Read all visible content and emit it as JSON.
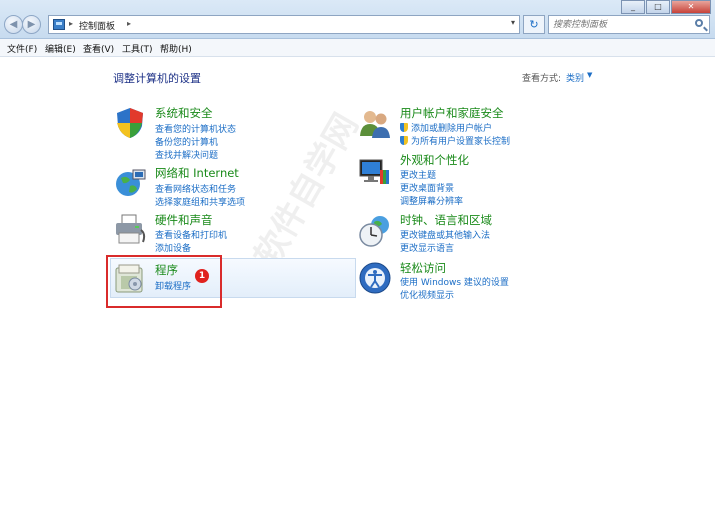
{
  "window": {
    "breadcrumb": "控制面板",
    "search_placeholder": "搜索控制面板",
    "min_label": "_",
    "max_label": "□",
    "close_label": "✕"
  },
  "menu": [
    "文件(F)",
    "编辑(E)",
    "查看(V)",
    "工具(T)",
    "帮助(H)"
  ],
  "page": {
    "title": "调整计算机的设置",
    "view_label": "查看方式:",
    "view_value": "类别"
  },
  "categories": [
    {
      "title": "系统和安全",
      "links": [
        "查看您的计算机状态",
        "备份您的计算机",
        "查找并解决问题"
      ],
      "icon": "shield-icon"
    },
    {
      "title": "网络和 Internet",
      "links": [
        "查看网络状态和任务",
        "选择家庭组和共享选项"
      ],
      "icon": "network-globe-icon"
    },
    {
      "title": "硬件和声音",
      "links": [
        "查看设备和打印机",
        "添加设备"
      ],
      "icon": "printer-icon"
    },
    {
      "title": "程序",
      "links": [
        "卸载程序"
      ],
      "icon": "programs-icon"
    },
    {
      "title": "用户帐户和家庭安全",
      "links": [
        "添加或删除用户帐户",
        "为所有用户设置家长控制"
      ],
      "icon": "users-icon"
    },
    {
      "title": "外观和个性化",
      "links": [
        "更改主题",
        "更改桌面背景",
        "调整屏幕分辨率"
      ],
      "icon": "monitor-paint-icon"
    },
    {
      "title": "时钟、语言和区域",
      "links": [
        "更改键盘或其他输入法",
        "更改显示语言"
      ],
      "icon": "clock-globe-icon"
    },
    {
      "title": "轻松访问",
      "links": [
        "使用 Windows 建议的设置",
        "优化视频显示"
      ],
      "icon": "ease-of-access-icon"
    }
  ],
  "annotation": {
    "badge": "1"
  },
  "watermark": "软件自学网"
}
